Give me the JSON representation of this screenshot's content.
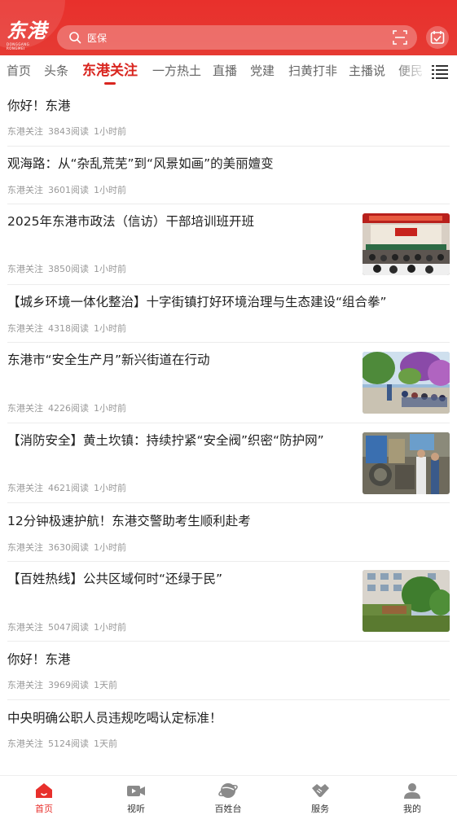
{
  "header": {
    "logo_text": "东港",
    "logo_sub": "DONGGANG RONGMEI",
    "search_placeholder": "医保",
    "brand_color": "#e8302c"
  },
  "tabs": [
    {
      "label": "首页",
      "active": false
    },
    {
      "label": "头条",
      "active": false
    },
    {
      "label": "东港关注",
      "active": true
    },
    {
      "label": "一方热土",
      "active": false
    },
    {
      "label": "直播",
      "active": false
    },
    {
      "label": "党建",
      "active": false
    },
    {
      "label": "扫黄打非",
      "active": false
    },
    {
      "label": "主播说",
      "active": false
    },
    {
      "label": "便民",
      "active": false
    }
  ],
  "articles": [
    {
      "title": "你好！东港",
      "source": "东港关注",
      "reads": "3843阅读",
      "time": "1小时前",
      "has_image": false
    },
    {
      "title": "观海路：从“杂乱荒芜”到“风景如画”的美丽嬗变",
      "source": "东港关注",
      "reads": "3601阅读",
      "time": "1小时前",
      "has_image": false
    },
    {
      "title": "2025年东港市政法（信访）干部培训班开班",
      "source": "东港关注",
      "reads": "3850阅读",
      "time": "1小时前",
      "has_image": true,
      "image": "training-meeting-photo"
    },
    {
      "title": "【城乡环境一体化整治】十字街镇打好环境治理与生态建设“组合拳”",
      "source": "东港关注",
      "reads": "4318阅读",
      "time": "1小时前",
      "has_image": false
    },
    {
      "title": "东港市“安全生产月”新兴街道在行动",
      "source": "东港关注",
      "reads": "4226阅读",
      "time": "1小时前",
      "has_image": true,
      "image": "street-event-photo"
    },
    {
      "title": "【消防安全】黄土坎镇：持续拧紧“安全阀”织密“防护网”",
      "source": "东港关注",
      "reads": "4621阅读",
      "time": "1小时前",
      "has_image": true,
      "image": "fire-inspection-photo"
    },
    {
      "title": "12分钟极速护航！东港交警助考生顺利赴考",
      "source": "东港关注",
      "reads": "3630阅读",
      "time": "1小时前",
      "has_image": false
    },
    {
      "title": "【百姓热线】公共区域何时“还绿于民”",
      "source": "东港关注",
      "reads": "5047阅读",
      "time": "1小时前",
      "has_image": true,
      "image": "residential-green-photo"
    },
    {
      "title": "你好！东港",
      "source": "东港关注",
      "reads": "3969阅读",
      "time": "1天前",
      "has_image": false
    },
    {
      "title": "中央明确公职人员违规吃喝认定标准！",
      "source": "东港关注",
      "reads": "5124阅读",
      "time": "1天前",
      "has_image": false
    }
  ],
  "bottom_nav": [
    {
      "label": "首页",
      "icon": "home-icon",
      "active": true
    },
    {
      "label": "视听",
      "icon": "video-icon",
      "active": false
    },
    {
      "label": "百姓台",
      "icon": "planet-icon",
      "active": false
    },
    {
      "label": "服务",
      "icon": "handshake-icon",
      "active": false
    },
    {
      "label": "我的",
      "icon": "user-icon",
      "active": false
    }
  ]
}
